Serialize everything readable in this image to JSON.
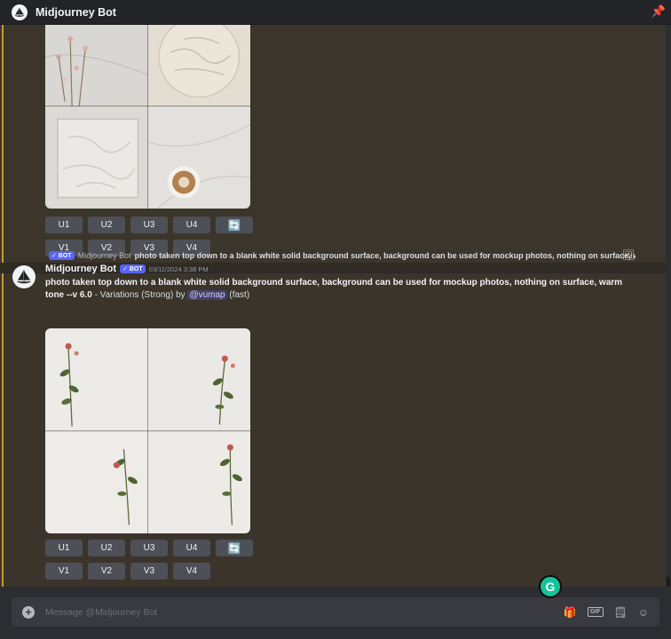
{
  "window": {
    "title": "Midjourney Bot"
  },
  "message1": {
    "upscale_buttons": [
      "U1",
      "U2",
      "U3",
      "U4"
    ],
    "variation_buttons": [
      "V1",
      "V2",
      "V3",
      "V4"
    ],
    "reroll_icon": "refresh-icon"
  },
  "message2": {
    "reply": {
      "badge": "✓ BOT",
      "author": "Midjourney Bot",
      "text": "photo taken top down to a blank white solid background surface, background can be used for mockup photos, nothing on surface, war"
    },
    "author": "Midjourney Bot",
    "badge": "✓ BOT",
    "timestamp": "03/11/2024 3:38 PM",
    "prompt": "photo taken top down to a blank white solid background surface, background can be used for mockup photos, nothing on surface, warm tone --v 6.0",
    "suffix_pre": " - Variations (Strong) by ",
    "mention": "@vumap",
    "suffix_post": " (fast)",
    "upscale_buttons": [
      "U1",
      "U2",
      "U3",
      "U4"
    ],
    "variation_buttons": [
      "V1",
      "V2",
      "V3",
      "V4"
    ],
    "reroll_icon": "refresh-icon"
  },
  "composer": {
    "placeholder": "Message @Midjourney Bot"
  },
  "colors": {
    "accent": "#c99b2a",
    "bot_badge": "#5865f2",
    "grammarly": "#15c39a"
  }
}
